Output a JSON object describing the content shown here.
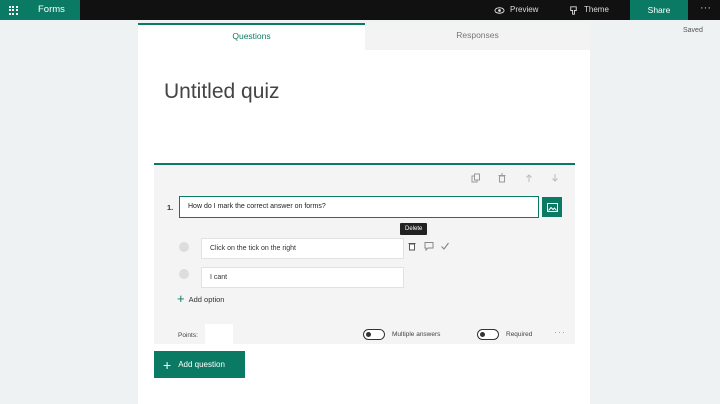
{
  "topbar": {
    "app_name": "Forms",
    "preview_label": "Preview",
    "theme_label": "Theme",
    "share_label": "Share",
    "more_label": "···"
  },
  "status": {
    "saved": "Saved"
  },
  "tabs": [
    {
      "label": "Questions",
      "active": true
    },
    {
      "label": "Responses",
      "active": false
    }
  ],
  "quiz": {
    "title": "Untitled quiz"
  },
  "question": {
    "number": "1.",
    "text": "How do I mark the correct answer on forms?",
    "options": [
      {
        "text": "Click on the tick on the right"
      },
      {
        "text": "I cant"
      }
    ],
    "tooltip": "Delete",
    "add_option_label": "Add option",
    "points_label": "Points:",
    "multiple_answers_label": "Multiple answers",
    "required_label": "Required",
    "more_label": "···"
  },
  "add_question_label": "Add question",
  "colors": {
    "accent": "#0b7a64",
    "topbar": "#111111"
  },
  "icons": [
    "waffle-icon",
    "preview-icon",
    "theme-icon",
    "copy-icon",
    "trash-icon",
    "move-up-icon",
    "move-down-icon",
    "image-icon",
    "delete-icon",
    "comment-icon",
    "check-icon",
    "plus-icon"
  ]
}
